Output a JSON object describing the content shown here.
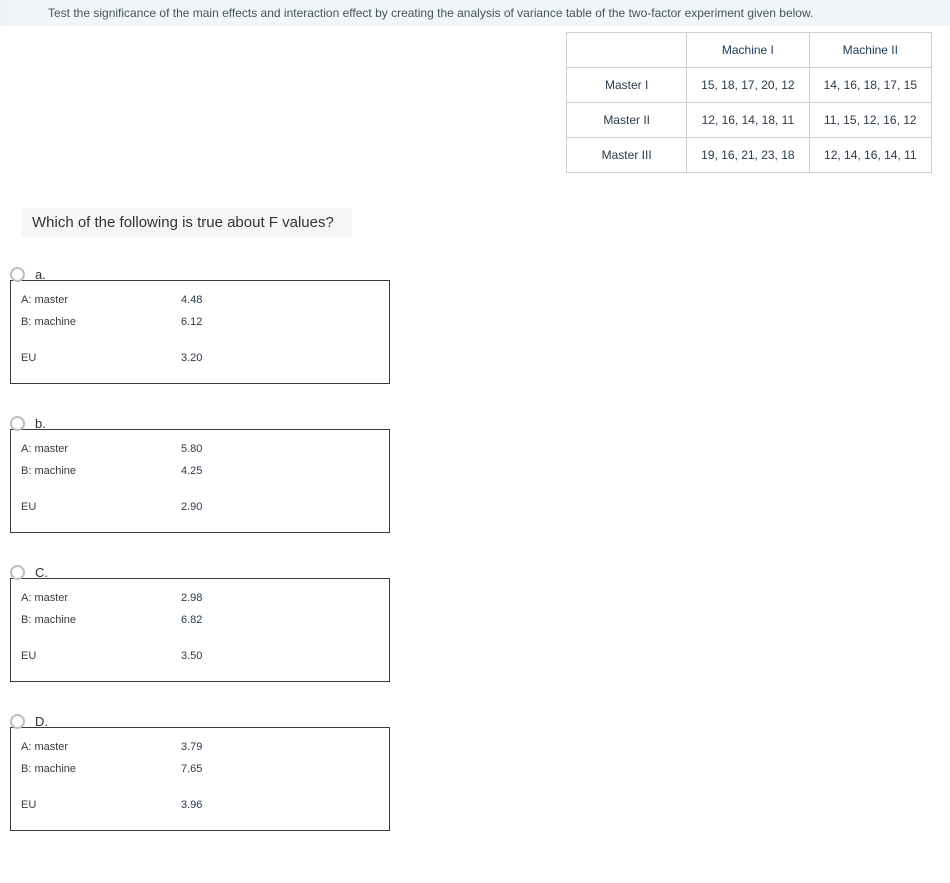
{
  "instruction": "Test the significance of the main effects and interaction effect by creating the analysis of variance table of the two-factor experiment given below.",
  "dataTable": {
    "colHeaders": [
      "Machine I",
      "Machine II"
    ],
    "rows": [
      {
        "header": "Master I",
        "c1": "15, 18, 17, 20, 12",
        "c2": "14, 16, 18, 17, 15"
      },
      {
        "header": "Master II",
        "c1": "12, 16, 14, 18, 11",
        "c2": "11, 15, 12, 16, 12"
      },
      {
        "header": "Master III",
        "c1": "19, 16, 21, 23, 18",
        "c2": "12, 14, 16, 14, 11"
      }
    ]
  },
  "question": "Which of the following is true about F values?",
  "rowLabels": {
    "a": "A: master",
    "b": "B: machine",
    "eu": "EU"
  },
  "options": [
    {
      "letter": "a.",
      "a": "4.48",
      "b": "6.12",
      "eu": "3.20"
    },
    {
      "letter": "b.",
      "a": "5.80",
      "b": "4.25",
      "eu": "2.90"
    },
    {
      "letter": "C.",
      "a": "2.98",
      "b": "6.82",
      "eu": "3.50"
    },
    {
      "letter": "D.",
      "a": "3.79",
      "b": "7.65",
      "eu": "3.96"
    }
  ]
}
